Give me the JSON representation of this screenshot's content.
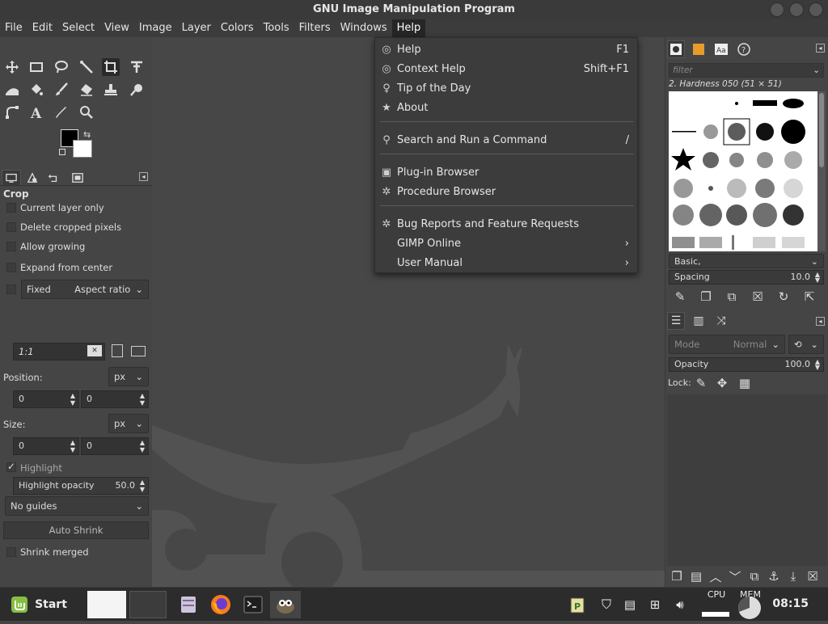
{
  "window": {
    "title": "GNU Image Manipulation Program"
  },
  "menubar": {
    "items": [
      "File",
      "Edit",
      "Select",
      "View",
      "Image",
      "Layer",
      "Colors",
      "Tools",
      "Filters",
      "Windows",
      "Help"
    ]
  },
  "help_menu": {
    "items": [
      {
        "icon": "help-icon",
        "label": "Help",
        "shortcut": "F1"
      },
      {
        "icon": "context-help-icon",
        "label": "Context Help",
        "shortcut": "Shift+F1"
      },
      {
        "icon": "lightbulb-icon",
        "label": "Tip of the Day",
        "shortcut": ""
      },
      {
        "icon": "star-icon",
        "label": "About",
        "shortcut": ""
      },
      {
        "icon": "search-icon",
        "label": "Search and Run a Command",
        "shortcut": "/"
      },
      {
        "icon": "plugin-icon",
        "label": "Plug-in Browser",
        "shortcut": ""
      },
      {
        "icon": "procedure-icon",
        "label": "Procedure Browser",
        "shortcut": ""
      },
      {
        "icon": "bug-icon",
        "label": "Bug Reports and Feature Requests",
        "shortcut": ""
      },
      {
        "icon": "",
        "label": "GIMP Online",
        "shortcut": "›"
      },
      {
        "icon": "",
        "label": "User Manual",
        "shortcut": "›"
      }
    ]
  },
  "tool_options": {
    "title": "Crop",
    "current_layer_only": "Current layer only",
    "delete_cropped": "Delete cropped pixels",
    "allow_growing": "Allow growing",
    "expand_center": "Expand from center",
    "fixed": "Fixed",
    "aspect": "Aspect ratio",
    "ratio_value": "1:1",
    "position_label": "Position:",
    "position_unit": "px",
    "pos_x": "0",
    "pos_y": "0",
    "size_label": "Size:",
    "size_unit": "px",
    "size_w": "0",
    "size_h": "0",
    "highlight": "Highlight",
    "highlight_opacity_label": "Highlight opacity",
    "highlight_opacity_value": "50.0",
    "guides": "No guides",
    "auto_shrink": "Auto Shrink",
    "shrink_merged": "Shrink merged"
  },
  "brushes": {
    "filter_placeholder": "filter",
    "selected": "2. Hardness 050 (51 × 51)",
    "tag": "Basic,",
    "spacing_label": "Spacing",
    "spacing_value": "10.0"
  },
  "layers": {
    "mode_label": "Mode",
    "mode_value": "Normal",
    "opacity_label": "Opacity",
    "opacity_value": "100.0",
    "lock_label": "Lock:"
  },
  "taskbar": {
    "start": "Start",
    "cpu": "CPU",
    "mem": "MEM",
    "clock": "08:15"
  }
}
